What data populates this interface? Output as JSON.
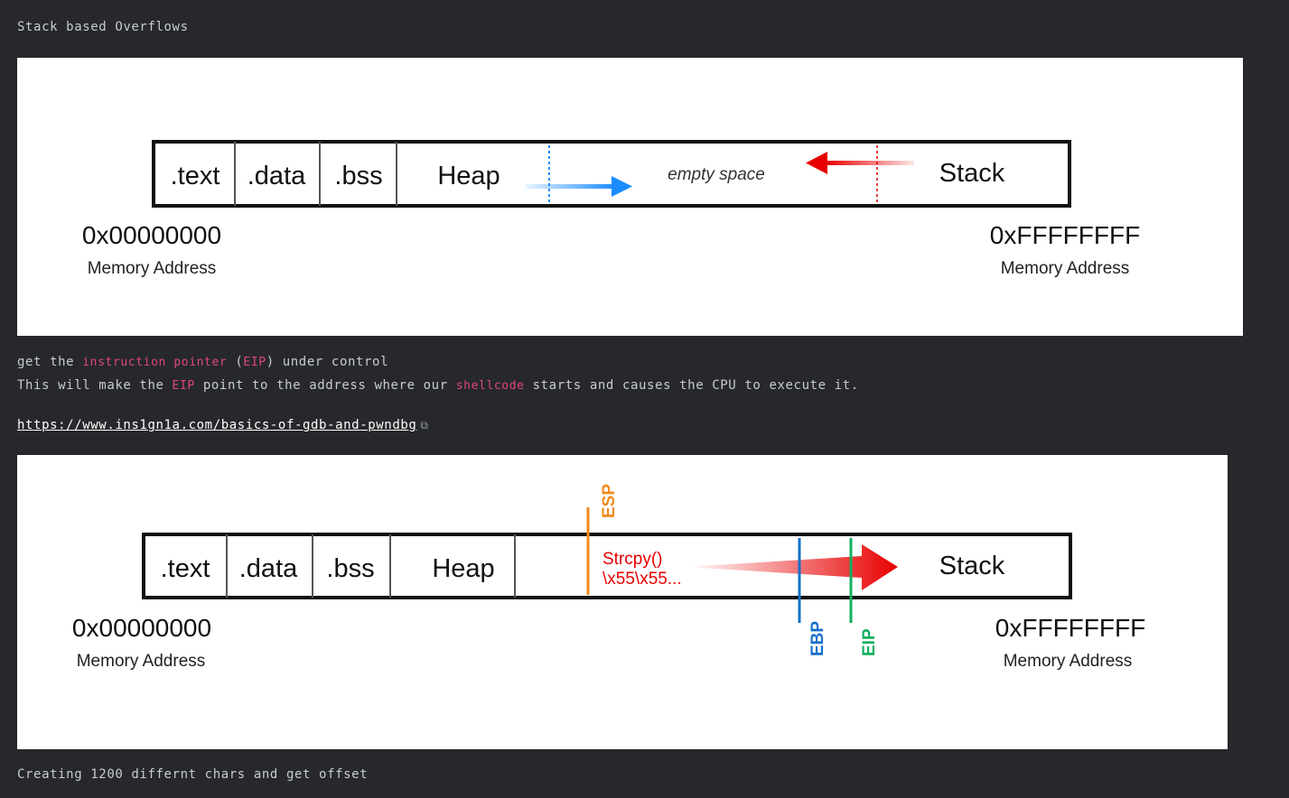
{
  "heading": "Stack based Overflows",
  "figure1": {
    "segments": [
      ".text",
      ".data",
      ".bss",
      "Heap"
    ],
    "empty_label": "empty space",
    "stack_label": "Stack",
    "addr_low": "0x00000000",
    "addr_high": "0xFFFFFFFF",
    "addr_caption": "Memory Address",
    "colors": {
      "heap_arrow": "#1a8cff",
      "stack_arrow": "#e80000"
    }
  },
  "line1": {
    "prefix": "get the ",
    "code1": "instruction pointer",
    "mid": " (",
    "code2": "EIP",
    "suffix": ") under control"
  },
  "line2": {
    "p1": "This will make the ",
    "code1": "EIP",
    "p2": " point to the address where our ",
    "code2": "shellcode",
    "p3": " starts and causes the CPU to execute it."
  },
  "link": {
    "text": "https://www.ins1gn1a.com/basics-of-gdb-and-pwndbg",
    "icon": "external-link-icon"
  },
  "figure2": {
    "segments": [
      ".text",
      ".data",
      ".bss",
      "Heap"
    ],
    "strcpy_line1": "Strcpy()",
    "strcpy_line2": "\\x55\\x55...",
    "stack_label": "Stack",
    "esp": "ESP",
    "ebp": "EBP",
    "eip": "EIP",
    "addr_low": "0x00000000",
    "addr_high": "0xFFFFFFFF",
    "addr_caption": "Memory Address",
    "colors": {
      "esp": "#f08a1c",
      "ebp": "#1670c8",
      "eip": "#12b060",
      "payload": "#e80000"
    }
  },
  "footer": "Creating 1200 differnt chars and get offset"
}
